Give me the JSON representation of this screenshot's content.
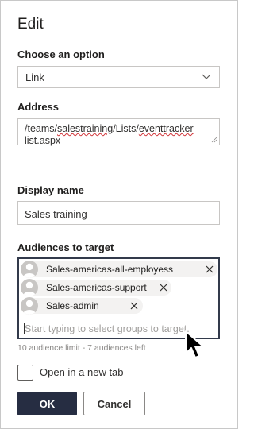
{
  "panel": {
    "title": "Edit"
  },
  "option": {
    "label": "Choose an option",
    "selected": "Link"
  },
  "address": {
    "label": "Address",
    "value_parts": [
      "/teams/",
      "salestraining",
      "/Lists/",
      "eventtracker",
      "\nlist.aspx"
    ]
  },
  "display_name": {
    "label": "Display name",
    "value": "Sales training"
  },
  "audiences": {
    "label": "Audiences to target",
    "selected": [
      {
        "name": "Sales-americas-all-employess"
      },
      {
        "name": "Sales-americas-support"
      },
      {
        "name": "Sales-admin"
      }
    ],
    "placeholder": "Start typing to select groups to target.",
    "limit_text": "10 audience limit - 7 audiences left"
  },
  "new_tab": {
    "label": "Open in a new tab",
    "checked": false
  },
  "buttons": {
    "ok": "OK",
    "cancel": "Cancel"
  },
  "colors": {
    "primary_button": "#262d42",
    "picker_border": "#323a4b",
    "spelling_squiggle": "#d13438"
  },
  "icons": [
    "chevron-down-icon",
    "resize-grip-icon",
    "avatar-icon",
    "remove-icon",
    "mouse-pointer-icon"
  ]
}
